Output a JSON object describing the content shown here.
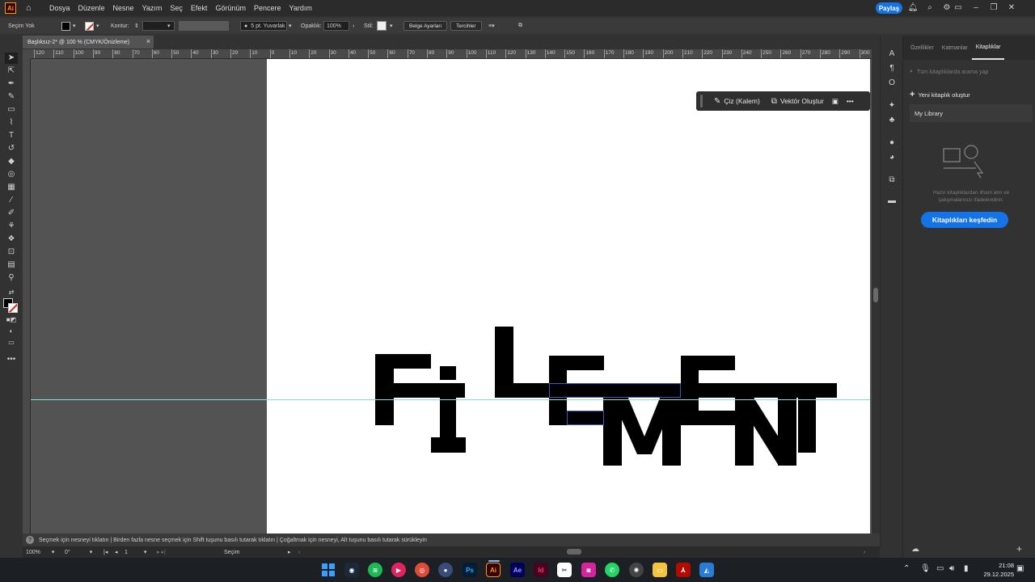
{
  "app": {
    "logo": "Ai",
    "menus": [
      "Dosya",
      "Düzenle",
      "Nesne",
      "Yazım",
      "Seç",
      "Efekt",
      "Görünüm",
      "Pencere",
      "Yardım"
    ],
    "share_label": "Paylaş"
  },
  "control": {
    "selection": "Seçim Yok",
    "stroke_label": "Kontur:",
    "brush": "5 pt. Yuvarlak",
    "opacity_label": "Opaklık:",
    "opacity_value": "100%",
    "style_label": "Stil:",
    "doc_settings": "Belge Ayarları",
    "preferences": "Tercihler"
  },
  "document": {
    "tab_title": "Başlıksız-2* @ 100 % (CMYK/Önizleme)",
    "close": "×"
  },
  "ruler": {
    "h_labels": [
      "120",
      "110",
      "100",
      "90",
      "80",
      "70",
      "60",
      "50",
      "40",
      "30",
      "20",
      "10",
      "0",
      "10",
      "20",
      "30",
      "40",
      "50",
      "60",
      "70",
      "80",
      "90",
      "100",
      "110",
      "120",
      "130",
      "140",
      "150",
      "160",
      "170",
      "180",
      "190",
      "200",
      "210",
      "220",
      "230",
      "240",
      "250",
      "260",
      "270",
      "280",
      "290",
      "300"
    ]
  },
  "context_toolbar": {
    "draw": "Çiz (Kalem)",
    "vectorize": "Vektör Oluştur",
    "more": "•••"
  },
  "panel": {
    "tabs": [
      "Özellikler",
      "Katmanlar",
      "Kitaplıklar"
    ],
    "search_placeholder": "Tüm kitaplıklarda arama yap",
    "new_library": "Yeni kitaplık oluştur",
    "library_name": "My Library",
    "hint": "Hazır kitaplıklardan ilham alın ve çalışmalarınızı ifadelendirin.",
    "explore": "Kitaplıkları keşfedin"
  },
  "hint_bar": "Seçmek için nesneyi tıklatın  |  Birden fazla nesne seçmek için Shift tuşunu basılı tutarak tıklatın  |  Çoğaltmak için nesneyi, Alt tuşunu basılı tutarak sürükleyin",
  "status": {
    "zoom": "100%",
    "rotation": "0°",
    "artboard": "1",
    "mode": "Seçim"
  },
  "taskbar": {
    "time": "21:08",
    "date": "29.12.2025"
  }
}
